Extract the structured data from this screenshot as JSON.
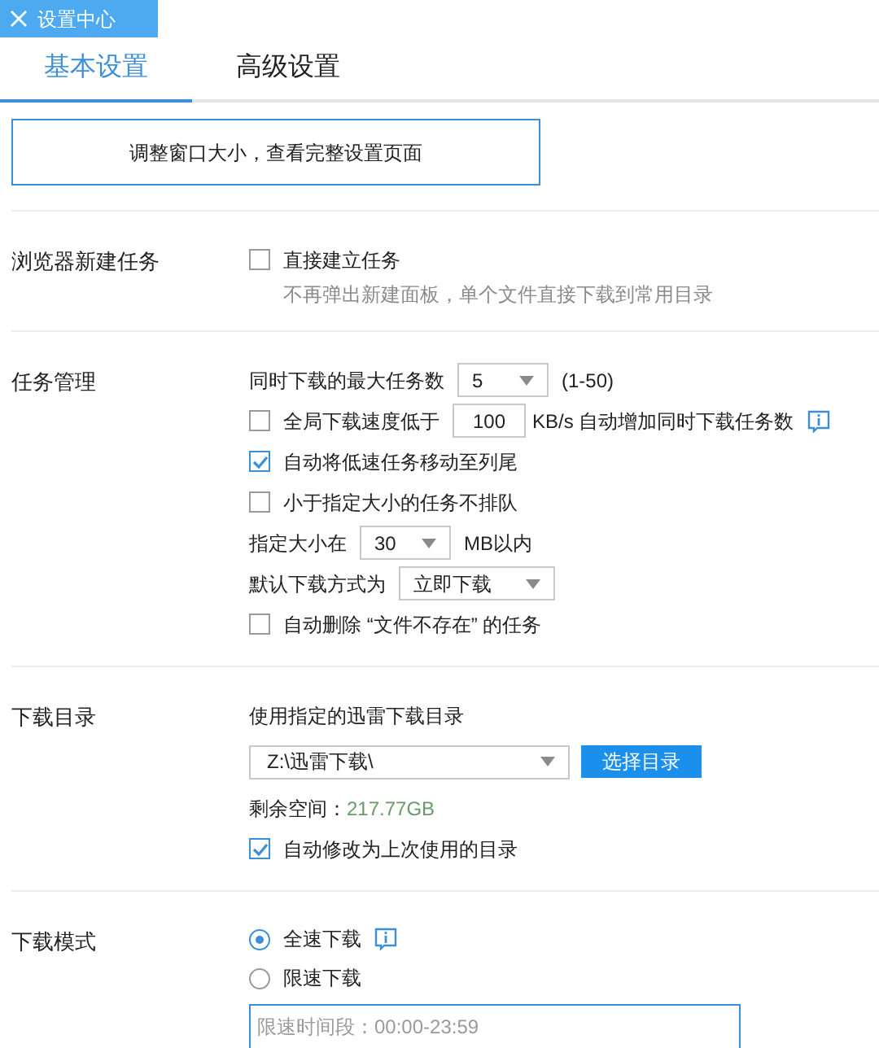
{
  "window": {
    "title": "设置中心"
  },
  "tabs": [
    {
      "label": "基本设置",
      "selected": true
    },
    {
      "label": "高级设置",
      "selected": false
    }
  ],
  "resize_notice": "调整窗口大小，查看完整设置页面",
  "sections": [
    {
      "label": "浏览器新建任务",
      "items": [
        {
          "kind": "checkbox",
          "label": "直接建立任务",
          "checked": false,
          "note": "不再弹出新建面板，单个文件直接下载到常用目录"
        }
      ]
    },
    {
      "label": "任务管理",
      "items": [
        {
          "kind": "select",
          "label": "同时下载的最大任务数",
          "value": "5",
          "suffix": "(1-50)"
        },
        {
          "kind": "checkbox-input",
          "label": "全局下载速度低于",
          "checked": false,
          "value": "100",
          "suffix": "KB/s 自动增加同时下载任务数",
          "info": true
        },
        {
          "kind": "checkbox",
          "label": "自动将低速任务移动至列尾",
          "checked": true
        },
        {
          "kind": "checkbox",
          "label": "小于指定大小的任务不排队",
          "checked": false
        },
        {
          "kind": "select",
          "label": "指定大小在",
          "value": "30",
          "suffix": "MB以内"
        },
        {
          "kind": "select",
          "label": "默认下载方式为",
          "value": "立即下载",
          "wide": true
        },
        {
          "kind": "checkbox",
          "label": "自动删除 “文件不存在” 的任务",
          "checked": false
        }
      ]
    },
    {
      "label": "下载目录",
      "items": [
        {
          "kind": "text",
          "label": "使用指定的迅雷下载目录"
        },
        {
          "kind": "directory",
          "value": "Z:\\迅雷下载\\",
          "button": "选择目录"
        },
        {
          "kind": "space",
          "label": "剩余空间：",
          "value": "217.77GB"
        },
        {
          "kind": "checkbox",
          "label": "自动修改为上次使用的目录",
          "checked": true
        }
      ]
    },
    {
      "label": "下载模式",
      "items": [
        {
          "kind": "radio",
          "label": "全速下载",
          "selected": true,
          "info": true
        },
        {
          "kind": "radio",
          "label": "限速下载",
          "selected": false
        },
        {
          "kind": "field",
          "placeholder": "限速时间段：00:00-23:59"
        }
      ]
    }
  ]
}
